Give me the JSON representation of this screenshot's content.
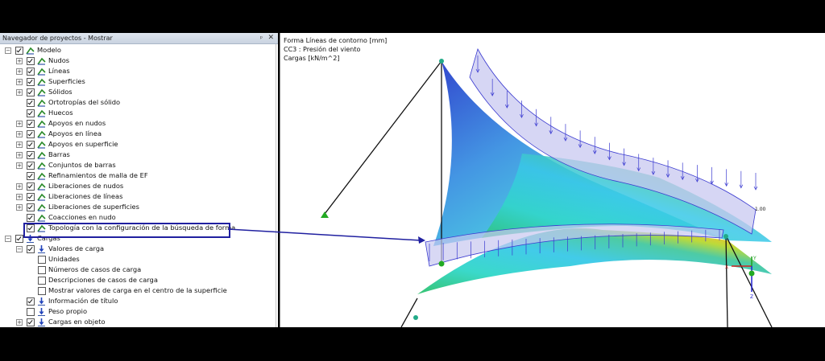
{
  "navigator": {
    "title": "Navegador de proyectos - Mostrar",
    "pin_glyph": "ᵖ",
    "close_glyph": "✕",
    "items": [
      {
        "label": "Modelo",
        "level": 0,
        "exp": "-",
        "checked": true,
        "icon": "model-icon"
      },
      {
        "label": "Nudos",
        "level": 1,
        "exp": "+",
        "checked": true,
        "icon": "model-icon"
      },
      {
        "label": "Líneas",
        "level": 1,
        "exp": "+",
        "checked": true,
        "icon": "model-icon"
      },
      {
        "label": "Superficies",
        "level": 1,
        "exp": "+",
        "checked": true,
        "icon": "model-icon"
      },
      {
        "label": "Sólidos",
        "level": 1,
        "exp": "+",
        "checked": true,
        "icon": "model-icon"
      },
      {
        "label": "Ortotropías del sólido",
        "level": 1,
        "exp": "",
        "checked": true,
        "icon": "model-icon"
      },
      {
        "label": "Huecos",
        "level": 1,
        "exp": "",
        "checked": true,
        "icon": "model-icon"
      },
      {
        "label": "Apoyos en nudos",
        "level": 1,
        "exp": "+",
        "checked": true,
        "icon": "model-icon"
      },
      {
        "label": "Apoyos en línea",
        "level": 1,
        "exp": "+",
        "checked": true,
        "icon": "model-icon"
      },
      {
        "label": "Apoyos en superficie",
        "level": 1,
        "exp": "+",
        "checked": true,
        "icon": "model-icon"
      },
      {
        "label": "Barras",
        "level": 1,
        "exp": "+",
        "checked": true,
        "icon": "model-icon"
      },
      {
        "label": "Conjuntos de barras",
        "level": 1,
        "exp": "+",
        "checked": true,
        "icon": "model-icon"
      },
      {
        "label": "Refinamientos de malla de EF",
        "level": 1,
        "exp": "",
        "checked": true,
        "icon": "model-icon"
      },
      {
        "label": "Liberaciones de nudos",
        "level": 1,
        "exp": "+",
        "checked": true,
        "icon": "model-icon"
      },
      {
        "label": "Liberaciones de líneas",
        "level": 1,
        "exp": "+",
        "checked": true,
        "icon": "model-icon"
      },
      {
        "label": "Liberaciones de superficies",
        "level": 1,
        "exp": "+",
        "checked": true,
        "icon": "model-icon"
      },
      {
        "label": "Coacciones en nudo",
        "level": 1,
        "exp": "",
        "checked": true,
        "icon": "model-icon"
      },
      {
        "label": "Topología con la configuración de la búsqueda de forma",
        "level": 1,
        "exp": "",
        "checked": true,
        "icon": "model-icon"
      },
      {
        "label": "Cargas",
        "level": 0,
        "exp": "-",
        "checked": true,
        "icon": "load-icon"
      },
      {
        "label": "Valores de carga",
        "level": 1,
        "exp": "-",
        "checked": true,
        "icon": "load-icon"
      },
      {
        "label": "Unidades",
        "level": 2,
        "exp": "",
        "checked": false,
        "icon": ""
      },
      {
        "label": "Números de casos de carga",
        "level": 2,
        "exp": "",
        "checked": false,
        "icon": ""
      },
      {
        "label": "Descripciones de casos de carga",
        "level": 2,
        "exp": "",
        "checked": false,
        "icon": ""
      },
      {
        "label": "Mostrar valores de carga en el centro de la superficie",
        "level": 2,
        "exp": "",
        "checked": false,
        "icon": ""
      },
      {
        "label": "Información de título",
        "level": 1,
        "exp": "",
        "checked": true,
        "icon": "load-icon"
      },
      {
        "label": "Peso propio",
        "level": 1,
        "exp": "",
        "checked": false,
        "icon": "load-icon"
      },
      {
        "label": "Cargas en objeto",
        "level": 1,
        "exp": "+",
        "checked": true,
        "icon": "load-icon"
      }
    ]
  },
  "viewport": {
    "info_lines": [
      "Forma Líneas de contorno [mm]",
      "CC3 : Presión del viento",
      "Cargas [kN/m^2]"
    ],
    "load_value": "1.00",
    "axis_x": "X",
    "axis_y": "Y",
    "axis_z": "Z"
  },
  "colors": {
    "highlight": "#2020a0",
    "load": "#3a3ad0",
    "support": "#22aa22"
  }
}
